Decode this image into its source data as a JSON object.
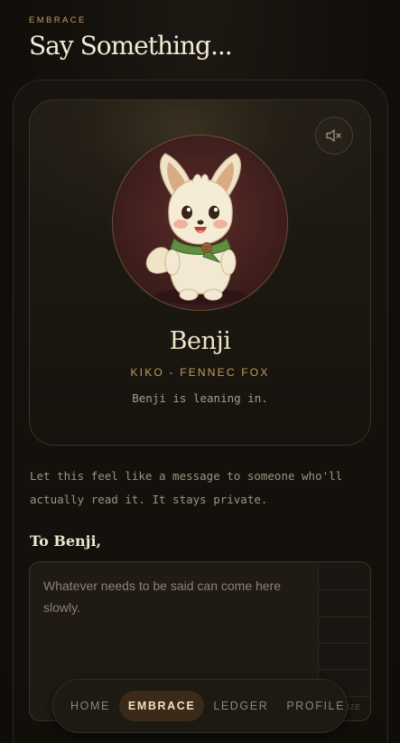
{
  "header": {
    "eyebrow": "EMBRACE",
    "title": "Say Something..."
  },
  "companion": {
    "name": "Benji",
    "species": "KIKO - FENNEC FOX",
    "status": "Benji is leaning in.",
    "mute_icon": "speaker-muted-icon",
    "avatar_icon": "fennec-fox-illustration"
  },
  "intro": {
    "line1": "Let this feel like a message to someone who'll",
    "line2": "actually read it. It stays private."
  },
  "compose": {
    "salutation": "To Benji,",
    "placeholder": "Whatever needs to be said can come here slowly.",
    "size_hint": "IZE"
  },
  "nav": {
    "items": [
      {
        "label": "HOME",
        "active": false
      },
      {
        "label": "EMBRACE",
        "active": true
      },
      {
        "label": "LEDGER",
        "active": false
      },
      {
        "label": "PROFILE",
        "active": false
      }
    ]
  },
  "colors": {
    "accent": "#c99b58",
    "background": "#120f0b",
    "active_nav": "#3a2a17"
  }
}
